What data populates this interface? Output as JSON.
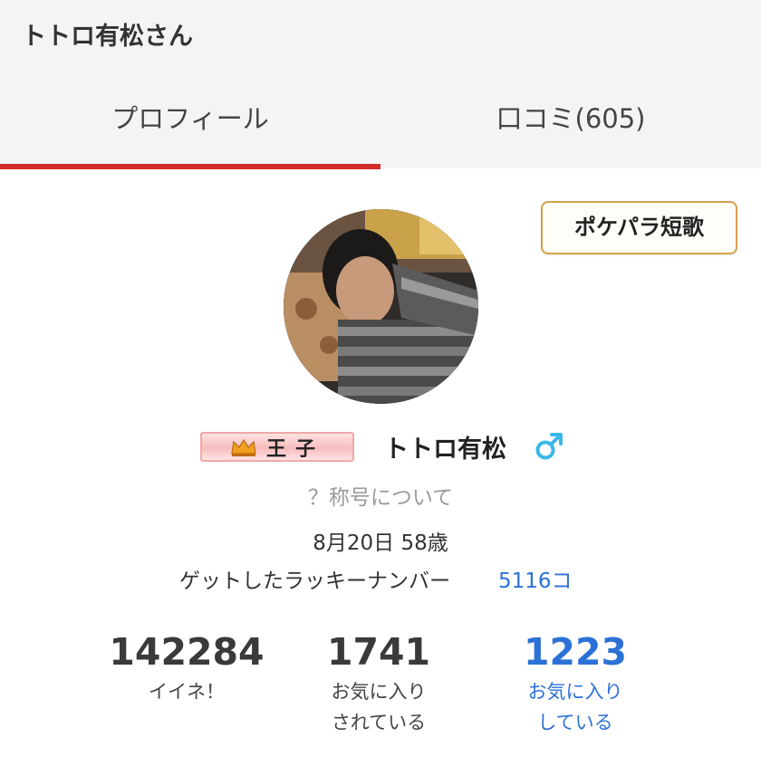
{
  "header": {
    "title": "トトロ有松さん"
  },
  "tabs": [
    {
      "label": "プロフィール",
      "active": true
    },
    {
      "label": "口コミ(605)",
      "active": false
    }
  ],
  "tanka_button": {
    "label": "ポケパラ短歌"
  },
  "profile": {
    "title_badge": "王子",
    "username": "トトロ有松",
    "gender_icon": "male-icon",
    "title_help": "？称号について",
    "birthday": "8月20日 58歳",
    "lucky_label": "ゲットしたラッキーナンバー",
    "lucky_count": "5116コ"
  },
  "stats": [
    {
      "value": "142284",
      "label_line1": "イイネ！",
      "label_line2": ""
    },
    {
      "value": "1741",
      "label_line1": "お気に入り",
      "label_line2": "されている"
    },
    {
      "value": "1223",
      "label_line1": "お気に入り",
      "label_line2": "している"
    }
  ],
  "colors": {
    "accent_red": "#d42a2a",
    "link_blue": "#2c72d6",
    "button_border": "#d4a24a",
    "gender_blue": "#3ab7e8"
  }
}
